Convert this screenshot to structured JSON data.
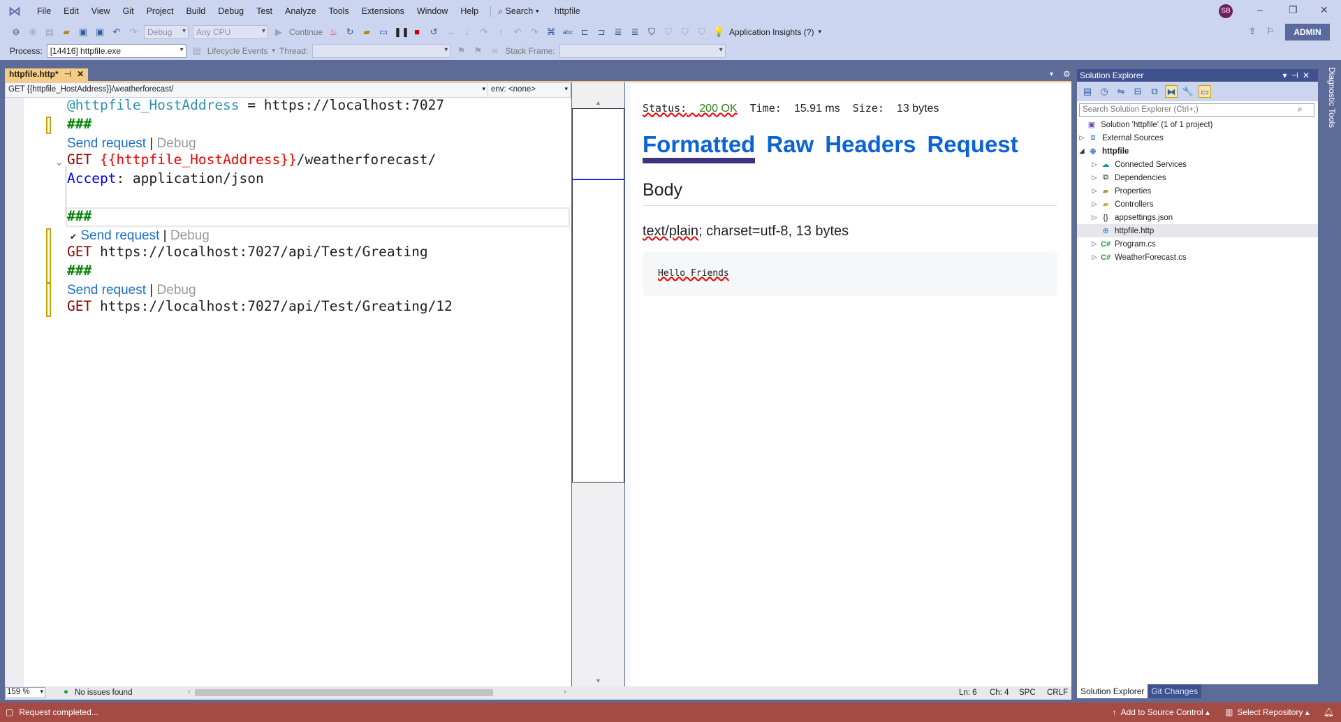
{
  "menu": {
    "items": [
      "File",
      "Edit",
      "View",
      "Git",
      "Project",
      "Build",
      "Debug",
      "Test",
      "Analyze",
      "Tools",
      "Extensions",
      "Window",
      "Help"
    ],
    "search": "Search",
    "title": "httpfile",
    "avatar": "SB"
  },
  "toolbar": {
    "config": "Debug",
    "platform": "Any CPU",
    "continue": "Continue",
    "app_insights": "Application Insights (?)",
    "admin": "ADMIN"
  },
  "toolbar2": {
    "process_label": "Process:",
    "process": "[14416] httpfile.exe",
    "lifecycle": "Lifecycle Events",
    "thread_label": "Thread:",
    "stack_label": "Stack Frame:"
  },
  "tab": {
    "label": "httpfile.http*"
  },
  "navbar": {
    "request": "GET {{httpfile_HostAddress}}/weatherforecast/",
    "env": "env: <none>"
  },
  "editor": {
    "line1": {
      "var": "@httpfile_HostAddress",
      "rest": " = https://localhost:7027"
    },
    "sep": "###",
    "send": "Send request",
    "pipe": " | ",
    "debug": "Debug",
    "check": "✔",
    "req1": {
      "method": "GET ",
      "var": "{{httpfile_HostAddress}}",
      "path": "/weatherforecast/"
    },
    "header": {
      "name": "Accept",
      "rest": ": application/json"
    },
    "req2": {
      "method": "GET ",
      "url": "https://localhost:7027/api/Test/Greating"
    },
    "req3": {
      "method": "GET ",
      "url": "https://localhost:7027/api/Test/Greating/12"
    }
  },
  "response": {
    "status_label": "Status:",
    "status": "200 OK",
    "time_label": "Time:",
    "time": "15.91 ms",
    "size_label": "Size:",
    "size": "13 bytes",
    "tabs": [
      "Formatted",
      "Raw",
      "Headers",
      "Request"
    ],
    "active_tab": "Formatted",
    "body_heading": "Body",
    "content_type": "text/plain",
    "content_rest": "; charset=utf-8, 13 bytes",
    "body": "Hello Friends"
  },
  "editor_status": {
    "zoom": "159 %",
    "issues": "No issues found",
    "ln": "Ln: 6",
    "ch": "Ch: 4",
    "spc": "SPC",
    "crlf": "CRLF"
  },
  "solution_explorer": {
    "title": "Solution Explorer",
    "search_placeholder": "Search Solution Explorer (Ctrl+;)",
    "items": [
      {
        "label": "Solution 'httpfile' (1 of 1 project)",
        "icon": "solution-icon"
      },
      {
        "label": "External Sources",
        "icon": "external-sources-icon"
      },
      {
        "label": "httpfile",
        "icon": "web-project-icon"
      },
      {
        "label": "Connected Services",
        "icon": "cloud-icon"
      },
      {
        "label": "Dependencies",
        "icon": "dependencies-icon"
      },
      {
        "label": "Properties",
        "icon": "properties-icon"
      },
      {
        "label": "Controllers",
        "icon": "folder-icon"
      },
      {
        "label": "appsettings.json",
        "icon": "json-icon"
      },
      {
        "label": "httpfile.http",
        "icon": "http-file-icon"
      },
      {
        "label": "Program.cs",
        "icon": "csharp-icon"
      },
      {
        "label": "WeatherForecast.cs",
        "icon": "csharp-icon"
      }
    ],
    "tabs": [
      "Solution Explorer",
      "Git Changes"
    ]
  },
  "diagnostic_tools": "Diagnostic Tools",
  "statusbar": {
    "message": "Request completed...",
    "source_control": "Add to Source Control",
    "repository": "Select Repository"
  },
  "colors": {
    "accent": "#5d6b99",
    "statusbar": "#a44b43",
    "tab_active": "#f5cc84",
    "link": "#0b63d6",
    "ok": "#2e7d1a"
  }
}
